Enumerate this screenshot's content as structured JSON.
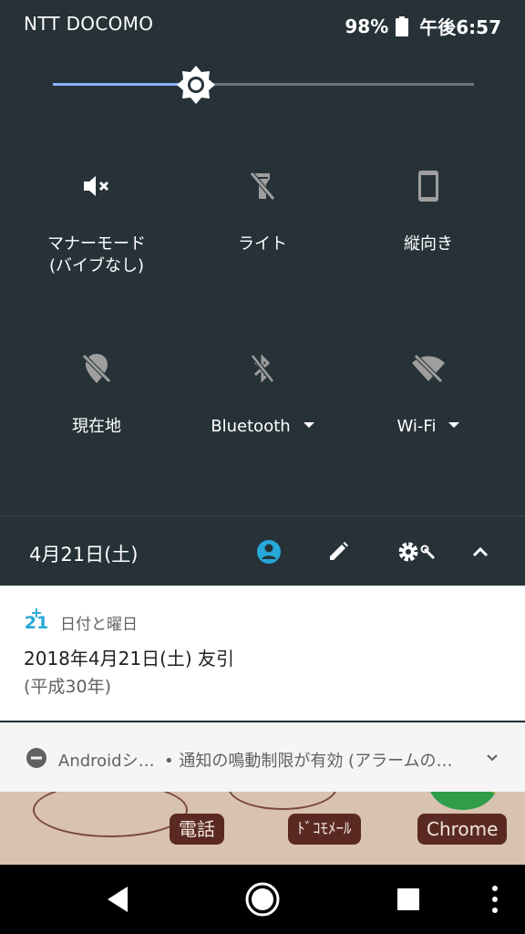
{
  "status_bar": {
    "carrier": "NTT DOCOMO",
    "battery": "98%",
    "time": "午後6:57"
  },
  "brightness": {
    "level": 0.34,
    "accent": "#8ab4f8"
  },
  "tiles": [
    {
      "id": "manner",
      "label": "マナーモード",
      "sublabel": "(バイブなし)",
      "icon": "volume-mute-icon"
    },
    {
      "id": "light",
      "label": "ライト",
      "icon": "flashlight-off-icon"
    },
    {
      "id": "orientation",
      "label": "縦向き",
      "icon": "phone-portrait-icon"
    },
    {
      "id": "location",
      "label": "現在地",
      "icon": "location-off-icon"
    },
    {
      "id": "bluetooth",
      "label": "Bluetooth",
      "icon": "bluetooth-off-icon"
    },
    {
      "id": "wifi",
      "label": "Wi-Fi",
      "icon": "wifi-off-icon"
    }
  ],
  "footer": {
    "date": "4月21日(土)"
  },
  "notification_date": {
    "cal_top": "+",
    "cal_num": "21",
    "app": "日付と曜日",
    "title": "2018年4月21日(土) 友引",
    "text": "(平成30年)"
  },
  "notification_system": {
    "app": "Androidシ…",
    "text": "• 通知の鳴動制限が有効 (アラームの…"
  },
  "home_peek": {
    "labels": [
      "電話",
      "ﾄﾞｺﾓﾒｰﾙ",
      "Chrome"
    ]
  },
  "colors": {
    "shade_bg": "#263238",
    "accent_teal": "#26a8d8"
  }
}
